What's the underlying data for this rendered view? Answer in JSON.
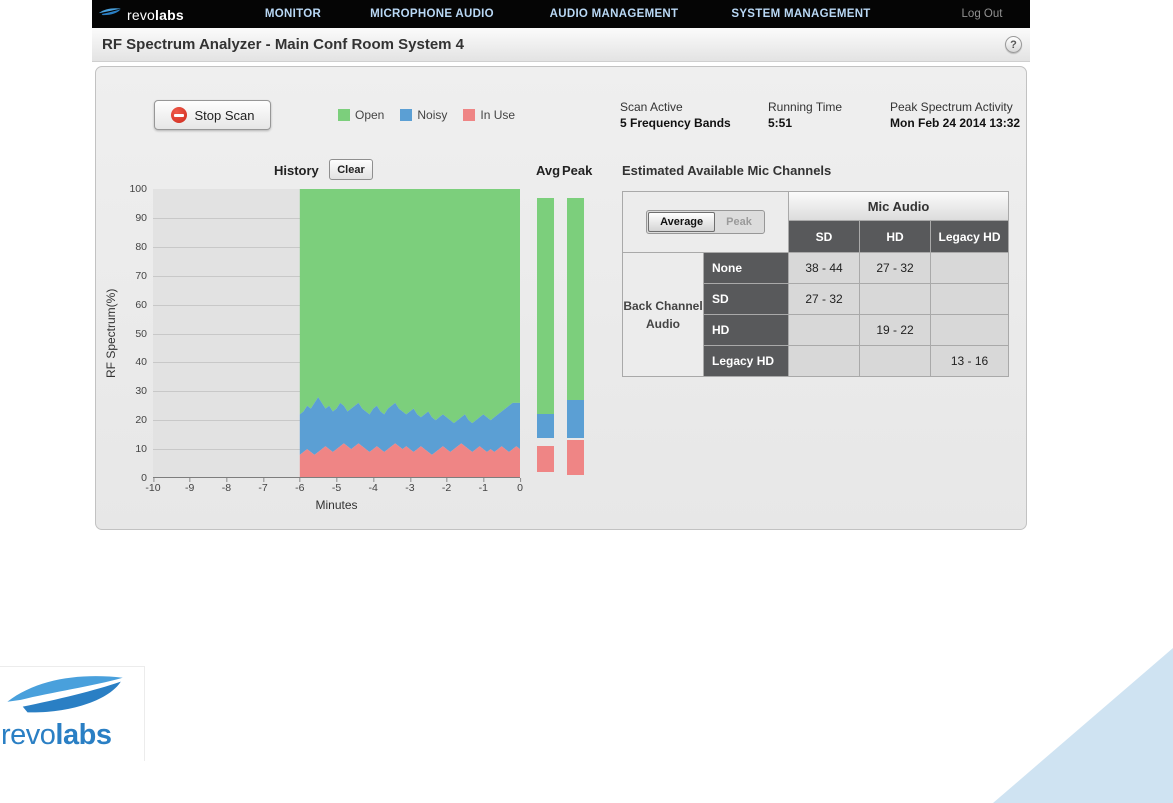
{
  "nav": {
    "brand_light": "revo",
    "brand_bold": "labs",
    "items": [
      {
        "label": "MONITOR"
      },
      {
        "label": "MICROPHONE AUDIO"
      },
      {
        "label": "AUDIO MANAGEMENT"
      },
      {
        "label": "SYSTEM MANAGEMENT"
      }
    ],
    "logout": "Log Out"
  },
  "header": {
    "title": "RF Spectrum Analyzer - Main Conf Room System 4",
    "help": "?"
  },
  "toolbar": {
    "stop_scan": "Stop Scan"
  },
  "legend": [
    {
      "label": "Open",
      "color": "#7ccf7c"
    },
    {
      "label": "Noisy",
      "color": "#5b9fd4"
    },
    {
      "label": "In Use",
      "color": "#ef8585"
    }
  ],
  "status": {
    "scan": {
      "label": "Scan Active",
      "value": "5 Frequency Bands"
    },
    "running": {
      "label": "Running Time",
      "value": "5:51"
    },
    "peak": {
      "label": "Peak Spectrum Activity",
      "value": "Mon Feb 24 2014 13:32"
    }
  },
  "history": {
    "title": "History",
    "clear_label": "Clear",
    "avg_label": "Avg",
    "peak_label": "Peak",
    "xlabel": "Minutes",
    "ylabel": "RF Spectrum(%)"
  },
  "channels": {
    "title": "Estimated Available Mic Channels",
    "toggle": {
      "average": "Average",
      "peak": "Peak",
      "selected": "Average"
    },
    "mic_audio_header": "Mic Audio",
    "col_headers": [
      "SD",
      "HD",
      "Legacy HD"
    ],
    "row_group_header": "Back Channel Audio",
    "rows": [
      {
        "header": "None",
        "cells": [
          "38 - 44",
          "27 - 32",
          ""
        ]
      },
      {
        "header": "SD",
        "cells": [
          "27 - 32",
          "",
          ""
        ]
      },
      {
        "header": "HD",
        "cells": [
          "",
          "19 - 22",
          ""
        ]
      },
      {
        "header": "Legacy HD",
        "cells": [
          "",
          "",
          "13 - 16"
        ]
      }
    ]
  },
  "footer": {
    "brand_light": "revo",
    "brand_bold": "labs"
  },
  "colors": {
    "open": "#7ccf7c",
    "noisy": "#5b9fd4",
    "inuse": "#ef8585",
    "accent_blue": "#2a7fc4",
    "corner": "#cfe3f2"
  },
  "chart_data": {
    "type": "area",
    "title": "History",
    "xlabel": "Minutes",
    "ylabel": "RF Spectrum(%)",
    "xlim": [
      -10,
      0
    ],
    "ylim": [
      0,
      100
    ],
    "xticks": [
      -10,
      -9,
      -8,
      -7,
      -6,
      -5,
      -4,
      -3,
      -2,
      -1,
      0
    ],
    "yticks": [
      0,
      10,
      20,
      30,
      40,
      50,
      60,
      70,
      80,
      90,
      100
    ],
    "grid": "horizontal",
    "x_start": -6,
    "x_step": 0.1,
    "series": [
      {
        "name": "In Use",
        "color": "#ef8585",
        "values": [
          8,
          9,
          10,
          9,
          8,
          9,
          10,
          11,
          10,
          9,
          10,
          11,
          12,
          11,
          10,
          11,
          12,
          11,
          10,
          9,
          10,
          11,
          10,
          9,
          10,
          11,
          12,
          11,
          10,
          11,
          10,
          9,
          10,
          11,
          10,
          9,
          8,
          9,
          10,
          11,
          10,
          9,
          10,
          11,
          12,
          11,
          10,
          9,
          10,
          11,
          10,
          9,
          10,
          9,
          10,
          11,
          10,
          9,
          10,
          11,
          10
        ]
      },
      {
        "name": "Noisy",
        "color": "#5b9fd4",
        "values": [
          22,
          23,
          25,
          24,
          26,
          28,
          26,
          24,
          25,
          23,
          24,
          26,
          25,
          23,
          24,
          25,
          26,
          24,
          23,
          22,
          24,
          25,
          23,
          22,
          24,
          25,
          26,
          24,
          23,
          22,
          23,
          24,
          22,
          21,
          22,
          23,
          21,
          20,
          21,
          22,
          21,
          20,
          19,
          20,
          21,
          22,
          20,
          19,
          20,
          21,
          22,
          21,
          20,
          21,
          22,
          23,
          24,
          25,
          26,
          26,
          26
        ]
      },
      {
        "name": "Open",
        "color": "#7ccf7c",
        "fill_to": 100
      }
    ],
    "summary_bars": {
      "avg": {
        "label": "Avg",
        "segments": [
          {
            "name": "Open",
            "color": "#7ccf7c",
            "from": 22,
            "to": 97
          },
          {
            "name": "Noisy",
            "color": "#5b9fd4",
            "from": 14,
            "to": 22
          },
          {
            "name": "In Use",
            "color": "#ef8585",
            "from": 2,
            "to": 11
          }
        ]
      },
      "peak": {
        "label": "Peak",
        "segments": [
          {
            "name": "Open",
            "color": "#7ccf7c",
            "from": 27,
            "to": 97
          },
          {
            "name": "Noisy",
            "color": "#5b9fd4",
            "from": 14,
            "to": 27
          },
          {
            "name": "In Use",
            "color": "#ef8585",
            "from": 1,
            "to": 13
          }
        ]
      }
    }
  }
}
